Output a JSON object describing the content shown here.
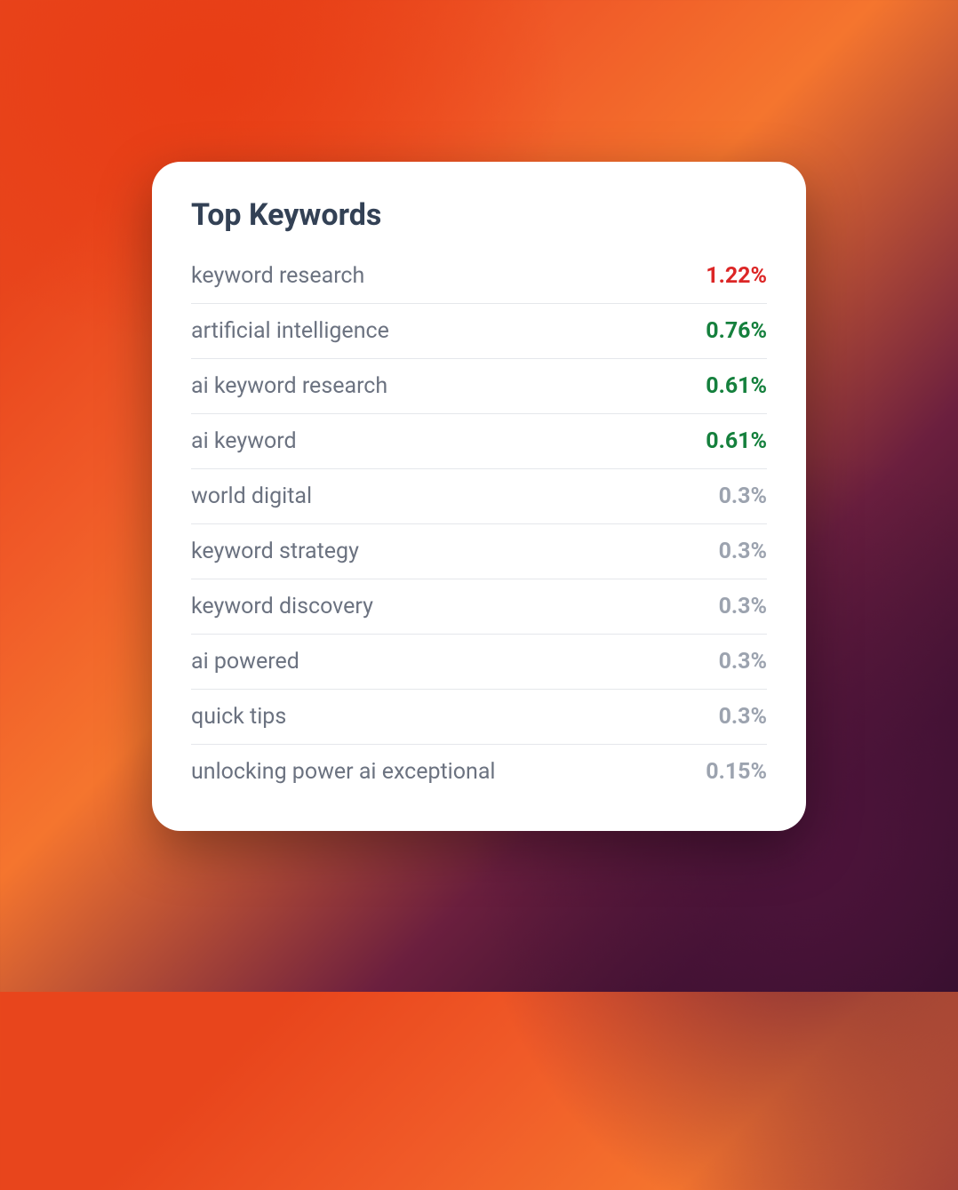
{
  "card": {
    "title": "Top Keywords",
    "keywords": [
      {
        "label": "keyword research",
        "value": "1.22%",
        "status": "red"
      },
      {
        "label": "artificial intelligence",
        "value": "0.76%",
        "status": "green"
      },
      {
        "label": "ai keyword research",
        "value": "0.61%",
        "status": "green"
      },
      {
        "label": "ai keyword",
        "value": "0.61%",
        "status": "green"
      },
      {
        "label": "world digital",
        "value": "0.3%",
        "status": "gray"
      },
      {
        "label": "keyword strategy",
        "value": "0.3%",
        "status": "gray"
      },
      {
        "label": "keyword discovery",
        "value": "0.3%",
        "status": "gray"
      },
      {
        "label": "ai powered",
        "value": "0.3%",
        "status": "gray"
      },
      {
        "label": "quick tips",
        "value": "0.3%",
        "status": "gray"
      },
      {
        "label": "unlocking power ai exceptional",
        "value": "0.15%",
        "status": "gray"
      }
    ]
  },
  "colors": {
    "red": "#dc2626",
    "green": "#15803d",
    "gray": "#9ca3af"
  }
}
